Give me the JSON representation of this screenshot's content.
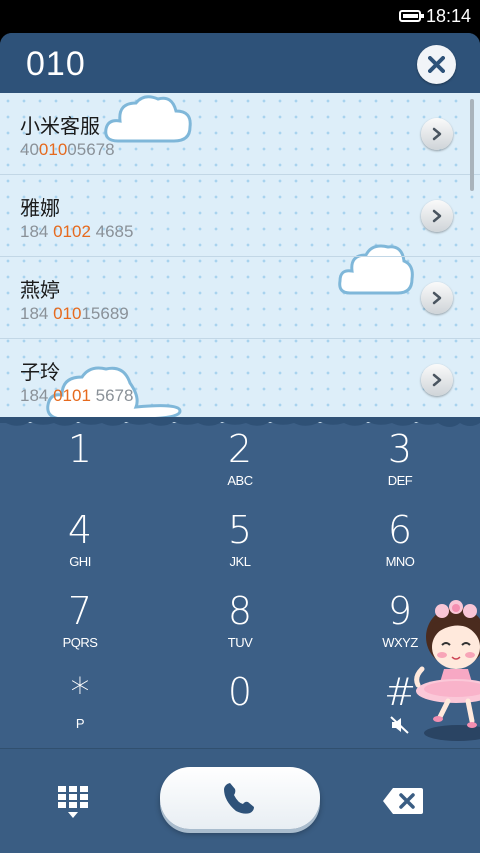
{
  "status_bar": {
    "time": "18:14",
    "battery_icon": "battery-icon",
    "battery_level": 0.85
  },
  "search": {
    "query": "010",
    "clear_icon": "close-icon"
  },
  "results": [
    {
      "name": "小米客服",
      "num_pre": "40",
      "num_hl": "010",
      "num_post": "05678"
    },
    {
      "name": "雅娜",
      "num_pre": "184 ",
      "num_hl": "0102",
      "num_post": " 4685"
    },
    {
      "name": "燕婷",
      "num_pre": "184 ",
      "num_hl": "010",
      "num_post": "15689"
    },
    {
      "name": "子玲",
      "num_pre": "184 ",
      "num_hl": "0101",
      "num_post": " 5678"
    }
  ],
  "keypad": [
    {
      "digit": "1",
      "letters": ""
    },
    {
      "digit": "2",
      "letters": "ABC"
    },
    {
      "digit": "3",
      "letters": "DEF"
    },
    {
      "digit": "4",
      "letters": "GHI"
    },
    {
      "digit": "5",
      "letters": "JKL"
    },
    {
      "digit": "6",
      "letters": "MNO"
    },
    {
      "digit": "7",
      "letters": "PQRS"
    },
    {
      "digit": "8",
      "letters": "TUV"
    },
    {
      "digit": "9",
      "letters": "WXYZ"
    },
    {
      "digit": "*",
      "letters": "P"
    },
    {
      "digit": "0",
      "letters": ""
    },
    {
      "digit": "#",
      "letters": ""
    }
  ],
  "bottom_bar": {
    "left_icon": "dialpad-grid-icon",
    "call_icon": "phone-icon",
    "right_icon": "backspace-icon"
  },
  "colors": {
    "accent": "#e66a1e",
    "header": "#2e5279",
    "keypad_bg": "#3c5f86",
    "list_bg": "#ddeef9"
  }
}
